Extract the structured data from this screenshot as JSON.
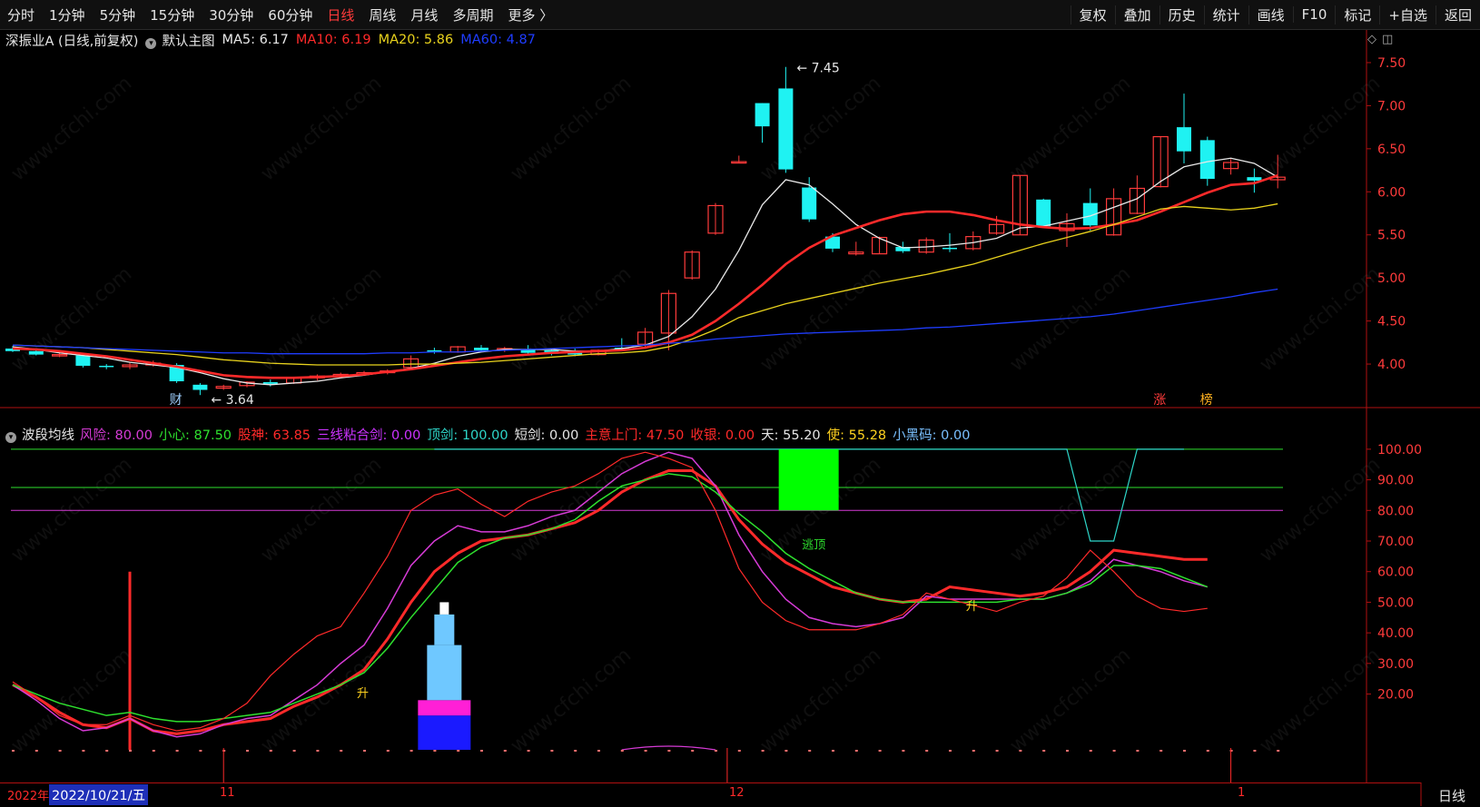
{
  "toolbar": {
    "periods": [
      {
        "label": "分时"
      },
      {
        "label": "1分钟"
      },
      {
        "label": "5分钟"
      },
      {
        "label": "15分钟"
      },
      {
        "label": "30分钟"
      },
      {
        "label": "60分钟"
      },
      {
        "label": "日线",
        "active": true
      },
      {
        "label": "周线"
      },
      {
        "label": "月线"
      },
      {
        "label": "多周期"
      },
      {
        "label": "更多 〉"
      }
    ],
    "actions": [
      {
        "label": "复权"
      },
      {
        "label": "叠加"
      },
      {
        "label": "历史"
      },
      {
        "label": "统计"
      },
      {
        "label": "画线"
      },
      {
        "label": "F10"
      },
      {
        "label": "标记"
      },
      {
        "label": "+自选"
      },
      {
        "label": "返回"
      }
    ]
  },
  "main_legend": {
    "title": "深振业A (日线,前复权)",
    "main_chart": "默认主图",
    "ma": [
      {
        "text": "MA5: 6.17",
        "color": "#e8e8e8"
      },
      {
        "text": "MA10: 6.19",
        "color": "#ff2a2a"
      },
      {
        "text": "MA20: 5.86",
        "color": "#e8d21d"
      },
      {
        "text": "MA60: 4.87",
        "color": "#1f3dff"
      }
    ]
  },
  "indicator_legend": {
    "title": "波段均线",
    "items": [
      {
        "text": "风险: 80.00",
        "color": "#d63bd6"
      },
      {
        "text": "小心: 87.50",
        "color": "#2ee02e"
      },
      {
        "text": "股神: 63.85",
        "color": "#ff2a2a"
      },
      {
        "text": "三线粘合剑: 0.00",
        "color": "#cc33ff"
      },
      {
        "text": "顶剑: 100.00",
        "color": "#2ed6c9"
      },
      {
        "text": "短剑: 0.00",
        "color": "#e6e6e6"
      },
      {
        "text": "主意上门: 47.50",
        "color": "#ff2a2a"
      },
      {
        "text": "收银: 0.00",
        "color": "#ff2a2a"
      },
      {
        "text": "天: 55.20",
        "color": "#e6e6e6"
      },
      {
        "text": "使: 55.28",
        "color": "#ffd21f"
      },
      {
        "text": "小黑码: 0.00",
        "color": "#7ac0ff"
      }
    ]
  },
  "chart_data": [
    {
      "type": "candlestick",
      "title": "深振业A (日线,前复权)",
      "ylim": [
        3.6,
        7.7
      ],
      "yticks": [
        "7.50",
        "7.00",
        "6.50",
        "6.00",
        "5.50",
        "5.00",
        "4.50",
        "4.00"
      ],
      "candles": [
        {
          "o": 4.18,
          "h": 4.21,
          "l": 4.14,
          "c": 4.15
        },
        {
          "o": 4.15,
          "h": 4.18,
          "l": 4.1,
          "c": 4.11
        },
        {
          "o": 4.11,
          "h": 4.14,
          "l": 4.08,
          "c": 4.11
        },
        {
          "o": 4.1,
          "h": 4.12,
          "l": 3.96,
          "c": 3.98
        },
        {
          "o": 3.98,
          "h": 4.0,
          "l": 3.94,
          "c": 3.97
        },
        {
          "o": 3.97,
          "h": 4.02,
          "l": 3.94,
          "c": 3.99
        },
        {
          "o": 3.99,
          "h": 4.04,
          "l": 3.97,
          "c": 4.01
        },
        {
          "o": 3.99,
          "h": 4.01,
          "l": 3.78,
          "c": 3.8
        },
        {
          "o": 3.76,
          "h": 3.78,
          "l": 3.64,
          "c": 3.7
        },
        {
          "o": 3.72,
          "h": 3.76,
          "l": 3.7,
          "c": 3.74
        },
        {
          "o": 3.75,
          "h": 3.8,
          "l": 3.73,
          "c": 3.79
        },
        {
          "o": 3.79,
          "h": 3.82,
          "l": 3.74,
          "c": 3.77
        },
        {
          "o": 3.78,
          "h": 3.85,
          "l": 3.77,
          "c": 3.84
        },
        {
          "o": 3.84,
          "h": 3.88,
          "l": 3.81,
          "c": 3.86
        },
        {
          "o": 3.86,
          "h": 3.9,
          "l": 3.84,
          "c": 3.88
        },
        {
          "o": 3.88,
          "h": 3.92,
          "l": 3.87,
          "c": 3.9
        },
        {
          "o": 3.9,
          "h": 3.94,
          "l": 3.88,
          "c": 3.92
        },
        {
          "o": 3.96,
          "h": 4.1,
          "l": 3.95,
          "c": 4.06
        },
        {
          "o": 4.16,
          "h": 4.19,
          "l": 4.12,
          "c": 4.15
        },
        {
          "o": 4.14,
          "h": 4.21,
          "l": 4.13,
          "c": 4.2
        },
        {
          "o": 4.19,
          "h": 4.22,
          "l": 4.14,
          "c": 4.16
        },
        {
          "o": 4.17,
          "h": 4.2,
          "l": 4.14,
          "c": 4.18
        },
        {
          "o": 4.17,
          "h": 4.22,
          "l": 4.12,
          "c": 4.13
        },
        {
          "o": 4.16,
          "h": 4.17,
          "l": 4.1,
          "c": 4.12
        },
        {
          "o": 4.15,
          "h": 4.18,
          "l": 4.09,
          "c": 4.11
        },
        {
          "o": 4.11,
          "h": 4.17,
          "l": 4.1,
          "c": 4.16
        },
        {
          "o": 4.19,
          "h": 4.3,
          "l": 4.16,
          "c": 4.17
        },
        {
          "o": 4.23,
          "h": 4.42,
          "l": 4.2,
          "c": 4.37
        },
        {
          "o": 4.36,
          "h": 4.86,
          "l": 4.16,
          "c": 4.82
        },
        {
          "o": 5.0,
          "h": 5.32,
          "l": 4.98,
          "c": 5.3
        },
        {
          "o": 5.52,
          "h": 5.87,
          "l": 5.5,
          "c": 5.84
        },
        {
          "o": 6.35,
          "h": 6.42,
          "l": 6.33,
          "c": 6.35
        },
        {
          "o": 7.03,
          "h": 7.03,
          "l": 6.57,
          "c": 6.76
        },
        {
          "o": 7.2,
          "h": 7.45,
          "l": 6.22,
          "c": 6.26
        },
        {
          "o": 6.05,
          "h": 6.17,
          "l": 5.65,
          "c": 5.68
        },
        {
          "o": 5.48,
          "h": 5.52,
          "l": 5.3,
          "c": 5.34
        },
        {
          "o": 5.28,
          "h": 5.42,
          "l": 5.26,
          "c": 5.3
        },
        {
          "o": 5.28,
          "h": 5.48,
          "l": 5.28,
          "c": 5.47
        },
        {
          "o": 5.36,
          "h": 5.42,
          "l": 5.29,
          "c": 5.31
        },
        {
          "o": 5.3,
          "h": 5.47,
          "l": 5.28,
          "c": 5.44
        },
        {
          "o": 5.35,
          "h": 5.52,
          "l": 5.3,
          "c": 5.34
        },
        {
          "o": 5.34,
          "h": 5.54,
          "l": 5.32,
          "c": 5.48
        },
        {
          "o": 5.52,
          "h": 5.72,
          "l": 5.5,
          "c": 5.62
        },
        {
          "o": 5.5,
          "h": 6.19,
          "l": 5.5,
          "c": 6.19
        },
        {
          "o": 5.91,
          "h": 5.92,
          "l": 5.58,
          "c": 5.6
        },
        {
          "o": 5.55,
          "h": 5.75,
          "l": 5.36,
          "c": 5.63
        },
        {
          "o": 5.87,
          "h": 6.04,
          "l": 5.55,
          "c": 5.61
        },
        {
          "o": 5.5,
          "h": 6.04,
          "l": 5.49,
          "c": 5.92
        },
        {
          "o": 5.75,
          "h": 6.19,
          "l": 5.74,
          "c": 6.04
        },
        {
          "o": 6.06,
          "h": 6.64,
          "l": 6.05,
          "c": 6.64
        },
        {
          "o": 6.75,
          "h": 7.14,
          "l": 6.33,
          "c": 6.47
        },
        {
          "o": 6.6,
          "h": 6.64,
          "l": 6.07,
          "c": 6.15
        },
        {
          "o": 6.27,
          "h": 6.38,
          "l": 6.2,
          "c": 6.34
        },
        {
          "o": 6.17,
          "h": 6.27,
          "l": 5.99,
          "c": 6.13
        },
        {
          "o": 6.14,
          "h": 6.43,
          "l": 6.04,
          "c": 6.17
        }
      ],
      "ma_lines": [
        {
          "name": "MA5",
          "color": "#e8e8e8",
          "values": [
            4.2,
            4.17,
            4.13,
            4.1,
            4.07,
            4.02,
            3.99,
            3.96,
            3.9,
            3.83,
            3.78,
            3.76,
            3.78,
            3.8,
            3.84,
            3.87,
            3.91,
            3.95,
            4.01,
            4.09,
            4.14,
            4.17,
            4.17,
            4.17,
            4.15,
            4.15,
            4.18,
            4.22,
            4.32,
            4.55,
            4.87,
            5.32,
            5.85,
            6.14,
            6.08,
            5.86,
            5.62,
            5.46,
            5.35,
            5.36,
            5.38,
            5.41,
            5.46,
            5.58,
            5.6,
            5.66,
            5.72,
            5.82,
            5.92,
            6.12,
            6.29,
            6.35,
            6.39,
            6.33,
            6.17
          ]
        },
        {
          "name": "MA10",
          "color": "#ff2a2a",
          "values": [
            4.18,
            4.17,
            4.15,
            4.12,
            4.09,
            4.05,
            4.01,
            3.97,
            3.92,
            3.87,
            3.85,
            3.84,
            3.84,
            3.85,
            3.86,
            3.88,
            3.91,
            3.94,
            3.98,
            4.02,
            4.06,
            4.09,
            4.11,
            4.13,
            4.14,
            4.15,
            4.16,
            4.19,
            4.25,
            4.34,
            4.5,
            4.7,
            4.92,
            5.16,
            5.35,
            5.49,
            5.58,
            5.67,
            5.74,
            5.77,
            5.77,
            5.73,
            5.67,
            5.62,
            5.59,
            5.57,
            5.58,
            5.62,
            5.67,
            5.77,
            5.88,
            5.99,
            6.08,
            6.1,
            6.19
          ]
        },
        {
          "name": "MA20",
          "color": "#e8d21d",
          "values": [
            4.22,
            4.21,
            4.2,
            4.19,
            4.17,
            4.15,
            4.13,
            4.11,
            4.08,
            4.05,
            4.03,
            4.01,
            4.0,
            3.99,
            3.99,
            3.99,
            3.99,
            4.0,
            4.0,
            4.01,
            4.02,
            4.04,
            4.06,
            4.08,
            4.1,
            4.12,
            4.13,
            4.15,
            4.2,
            4.29,
            4.4,
            4.54,
            4.62,
            4.7,
            4.76,
            4.82,
            4.88,
            4.94,
            4.99,
            5.04,
            5.1,
            5.16,
            5.24,
            5.32,
            5.4,
            5.47,
            5.54,
            5.62,
            5.71,
            5.8,
            5.83,
            5.81,
            5.79,
            5.81,
            5.86
          ]
        },
        {
          "name": "MA60",
          "color": "#1f3dff",
          "values": [
            4.22,
            4.21,
            4.2,
            4.19,
            4.18,
            4.17,
            4.16,
            4.15,
            4.14,
            4.13,
            4.13,
            4.12,
            4.12,
            4.12,
            4.12,
            4.12,
            4.13,
            4.13,
            4.14,
            4.14,
            4.15,
            4.16,
            4.17,
            4.18,
            4.19,
            4.2,
            4.21,
            4.22,
            4.24,
            4.26,
            4.29,
            4.31,
            4.33,
            4.35,
            4.36,
            4.37,
            4.38,
            4.39,
            4.4,
            4.42,
            4.43,
            4.45,
            4.47,
            4.49,
            4.51,
            4.53,
            4.55,
            4.58,
            4.62,
            4.66,
            4.7,
            4.74,
            4.78,
            4.83,
            4.87
          ]
        }
      ],
      "annotations": [
        {
          "text": "7.45",
          "index": 33,
          "value": 7.45
        },
        {
          "text": "3.64",
          "index": 8,
          "value": 3.64
        },
        {
          "text": "财",
          "index": 7,
          "color": "#9fd0ff"
        },
        {
          "text": "涨",
          "index": 49,
          "color": "#ff3b3b"
        },
        {
          "text": "榜",
          "index": 51,
          "color": "#ffb01f"
        }
      ]
    },
    {
      "type": "line",
      "title": "波段均线",
      "ylim": [
        0,
        105
      ],
      "yticks": [
        "100.00",
        "90.00",
        "80.00",
        "70.00",
        "60.00",
        "50.00",
        "40.00",
        "30.00",
        "20.00"
      ],
      "levels": [
        {
          "value": 100,
          "color": "#2ee02e"
        },
        {
          "value": 87.5,
          "color": "#2ee02e"
        },
        {
          "value": 80,
          "color": "#d63bd6"
        }
      ],
      "series": [
        {
          "name": "股神",
          "color": "#ff2a2a",
          "width": 3,
          "values": [
            23,
            19,
            14,
            10,
            9,
            12,
            8,
            7,
            8,
            10,
            11,
            12,
            16,
            19,
            23,
            28,
            38,
            50,
            60,
            66,
            70,
            71,
            72,
            74,
            76,
            80,
            86,
            90,
            93,
            93,
            88,
            77,
            69,
            63,
            59,
            55,
            53,
            51,
            50,
            51,
            55,
            54,
            53,
            52,
            53,
            55,
            60,
            67,
            66,
            65,
            64,
            64
          ]
        },
        {
          "name": "风险",
          "color": "#d63bd6",
          "width": 1.5,
          "values": [
            23,
            18,
            12,
            8,
            9,
            12,
            8,
            6,
            7,
            10,
            12,
            13,
            18,
            23,
            30,
            36,
            48,
            62,
            70,
            75,
            73,
            73,
            75,
            78,
            80,
            86,
            92,
            96,
            99,
            97,
            88,
            72,
            60,
            51,
            45,
            43,
            42,
            43,
            45,
            52,
            51,
            51,
            51,
            51,
            51,
            53,
            57,
            64,
            62,
            60,
            57,
            55
          ]
        },
        {
          "name": "小心",
          "color": "#2ee02e",
          "width": 1.5,
          "values": [
            23,
            20,
            17,
            15,
            13,
            14,
            12,
            11,
            11,
            12,
            13,
            14,
            17,
            20,
            23,
            27,
            35,
            45,
            54,
            63,
            68,
            71,
            72,
            74,
            77,
            83,
            88,
            90,
            92,
            91,
            86,
            79,
            73,
            66,
            61,
            57,
            53,
            51,
            50,
            50,
            50,
            50,
            50,
            51,
            51,
            53,
            56,
            62,
            62,
            61,
            58,
            55
          ]
        },
        {
          "name": "主意上门",
          "color": "#ff2a2a",
          "width": 1.2,
          "values": [
            24,
            19,
            13,
            10,
            10,
            13,
            10,
            8,
            9,
            12,
            17,
            26,
            33,
            39,
            42,
            53,
            65,
            80,
            85,
            87,
            82,
            78,
            83,
            86,
            88,
            92,
            97,
            99,
            97,
            94,
            80,
            61,
            50,
            44,
            41,
            41,
            41,
            43,
            46,
            53,
            51,
            49,
            47,
            50,
            52,
            58,
            67,
            60,
            52,
            48,
            47,
            48
          ]
        }
      ],
      "top_sword": [
        100,
        100,
        100,
        100,
        100,
        100,
        100,
        100,
        100,
        100,
        100,
        100,
        100,
        100,
        100,
        100,
        100,
        100,
        100,
        100,
        100,
        100,
        100,
        100,
        100,
        100,
        100,
        100,
        70,
        70,
        100,
        100,
        100
      ],
      "markers": [
        {
          "text": "升",
          "index": 15,
          "value": 20.5,
          "color": "#ffd21f"
        },
        {
          "text": "逃顶",
          "index": 34,
          "value": 69,
          "color": "#2ee02e"
        },
        {
          "text": "升",
          "index": 41,
          "value": 49,
          "color": "#ffd21f"
        }
      ]
    }
  ],
  "axis": {
    "date_prefix": "2022年",
    "cursor_date": "2022/10/21/五",
    "months": [
      "11",
      "12",
      "1"
    ],
    "period": "日线"
  }
}
